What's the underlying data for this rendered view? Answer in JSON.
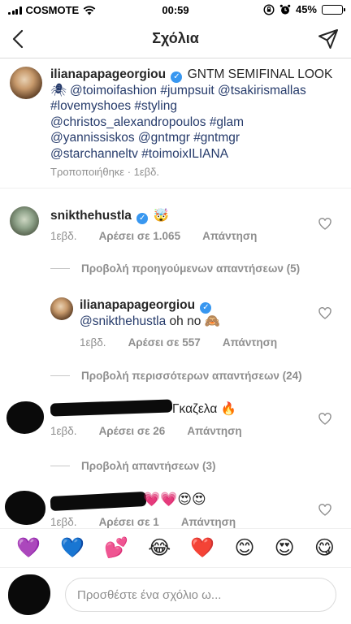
{
  "status": {
    "carrier": "COSMOTE",
    "time": "00:59",
    "battery": "45%",
    "battery_level": 0.45
  },
  "nav": {
    "title": "Σχόλια",
    "back_icon": "chevron-left-icon",
    "send_icon": "paper-plane-icon"
  },
  "caption": {
    "username": "ilianapapageorgiou",
    "line1_rest": "GNTM SEMIFINAL LOOK",
    "line2": "🕷 @toimoifashion #jumpsuit @tsakirismallas",
    "line3": "#lovemyshoes #styling",
    "line4": "@christos_alexandropoulos #glam",
    "line5": "@yannissiskos @gntmgr #gntmgr",
    "line6": "@starchanneltv #toimoixILIANA",
    "meta": "Τροποποιήθηκε · 1εβδ."
  },
  "comments": [
    {
      "username": "snikthehustla",
      "text": "🤯",
      "time": "1εβδ.",
      "likes": "Αρέσει σε 1.065",
      "reply": "Απάντηση",
      "view_replies": "Προβολή προηγούμενων απαντήσεων (5)"
    },
    {
      "username": "ilianapapageorgiou",
      "mention": "@snikthehustla",
      "text": "oh no 🙈",
      "time": "1εβδ.",
      "likes": "Αρέσει σε 557",
      "reply": "Απάντηση",
      "view_replies": "Προβολή περισσότερων απαντήσεων (24)"
    },
    {
      "text": "Γκαζελα 🔥",
      "time": "1εβδ.",
      "likes": "Αρέσει σε 26",
      "reply": "Απάντηση",
      "view_replies": "Προβολή απαντήσεων (3)"
    },
    {
      "text": "💗💗😍😍",
      "time": "1εβδ.",
      "likes": "Αρέσει σε 1",
      "reply": "Απάντηση"
    }
  ],
  "emoji_bar": [
    "💜",
    "💙",
    "💕",
    "😂",
    "❤️",
    "😊",
    "😍",
    "😋"
  ],
  "input": {
    "placeholder": "Προσθέστε ένα σχόλιο ω..."
  }
}
